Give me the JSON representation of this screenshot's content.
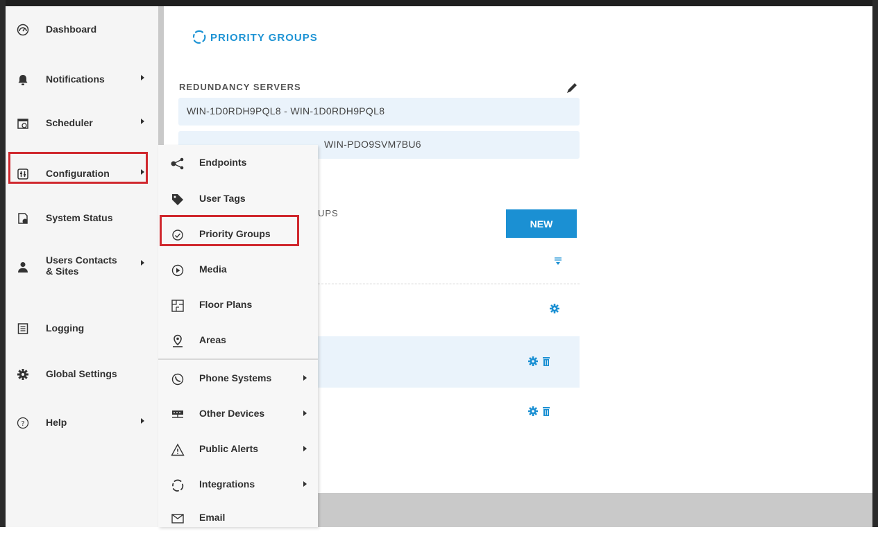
{
  "sidebar": {
    "items": [
      {
        "label": "Dashboard",
        "icon": "dashboard-icon",
        "has_arrow": false
      },
      {
        "label": "Notifications",
        "icon": "bell-icon",
        "has_arrow": true
      },
      {
        "label": "Scheduler",
        "icon": "calendar-clock-icon",
        "has_arrow": true
      },
      {
        "label": "Configuration",
        "icon": "configuration-icon",
        "has_arrow": true
      },
      {
        "label": "System Status",
        "icon": "system-status-icon",
        "has_arrow": false
      },
      {
        "label": "Users Contacts & Sites",
        "label_line1": "Users Contacts",
        "label_line2": "& Sites",
        "icon": "user-icon",
        "has_arrow": true
      },
      {
        "label": "Logging",
        "icon": "log-icon",
        "has_arrow": false
      },
      {
        "label": "Global Settings",
        "icon": "gear-icon",
        "has_arrow": false
      },
      {
        "label": "Help",
        "icon": "help-icon",
        "has_arrow": true
      }
    ]
  },
  "flyout": {
    "items": [
      {
        "label": "Endpoints",
        "icon": "share-icon"
      },
      {
        "label": "User Tags",
        "icon": "tag-icon"
      },
      {
        "label": "Priority Groups",
        "icon": "priority-icon"
      },
      {
        "label": "Media",
        "icon": "play-circle-icon"
      },
      {
        "label": "Floor Plans",
        "icon": "floor-plan-icon"
      },
      {
        "label": "Areas",
        "icon": "map-pin-icon"
      },
      {
        "label": "Phone Systems",
        "icon": "phone-icon"
      },
      {
        "label": "Other Devices",
        "icon": "devices-icon"
      },
      {
        "label": "Public Alerts",
        "icon": "warning-icon"
      },
      {
        "label": "Integrations",
        "icon": "integrations-icon"
      },
      {
        "label": "Email",
        "icon": "email-icon"
      }
    ]
  },
  "main": {
    "title": "PRIORITY GROUPS",
    "redundancy_label": "REDUNDANCY SERVERS",
    "servers": [
      "WIN-1D0RDH9PQL8 - WIN-1D0RDH9PQL8",
      "WIN-PDO9SVM7BU6"
    ],
    "groups_label_partial": "UPS",
    "new_button": "NEW"
  },
  "colors": {
    "accent": "#1b90d3",
    "highlight_red": "#d0282e",
    "row_band": "#eaf3fb"
  }
}
